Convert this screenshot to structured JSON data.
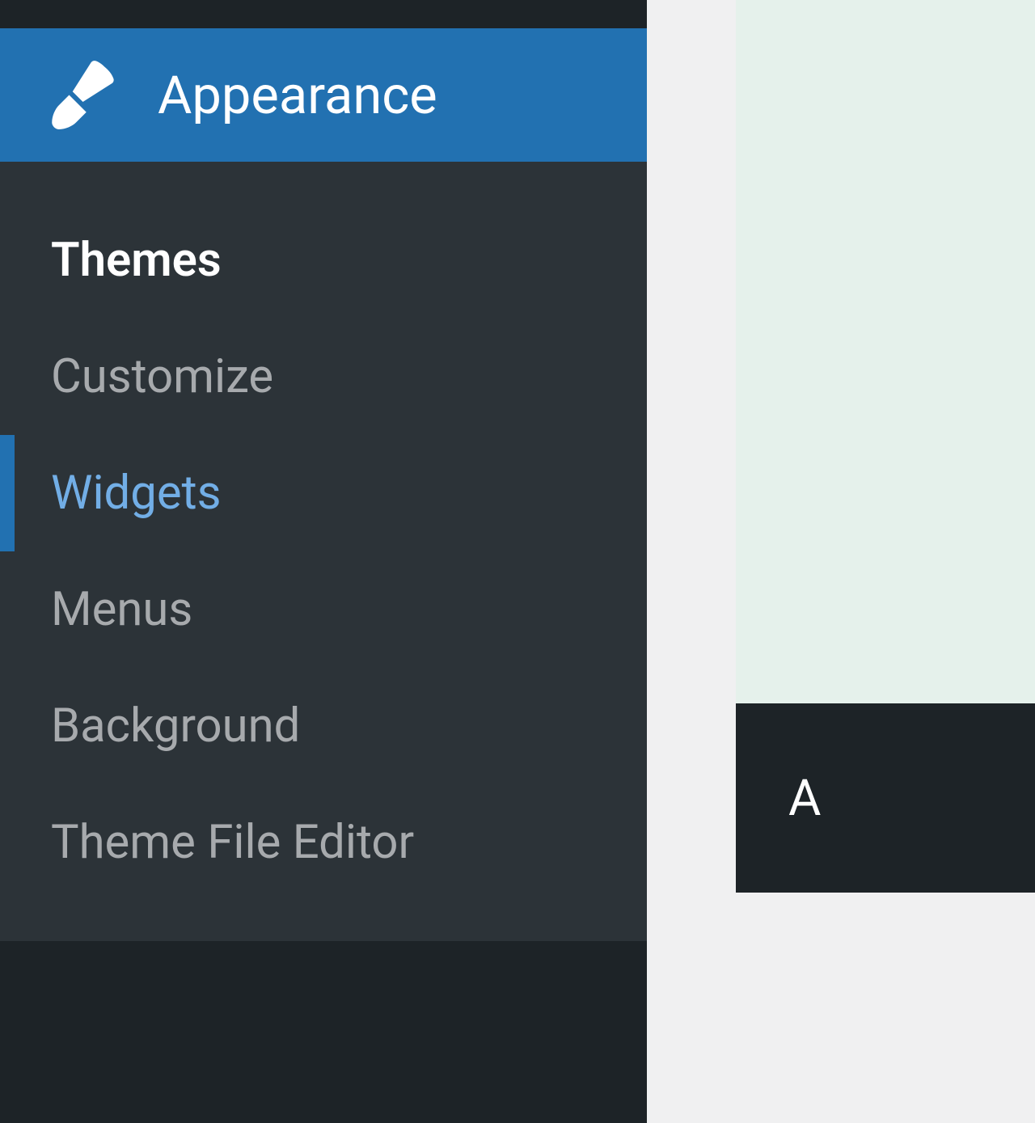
{
  "sidebar": {
    "header": {
      "icon": "paintbrush-icon",
      "label": "Appearance"
    },
    "submenu": [
      {
        "label": "Themes",
        "state": "active"
      },
      {
        "label": "Customize",
        "state": "normal"
      },
      {
        "label": "Widgets",
        "state": "current"
      },
      {
        "label": "Menus",
        "state": "normal"
      },
      {
        "label": "Background",
        "state": "normal"
      },
      {
        "label": "Theme File Editor",
        "state": "normal"
      }
    ]
  },
  "content": {
    "partial_button_text": "A"
  }
}
